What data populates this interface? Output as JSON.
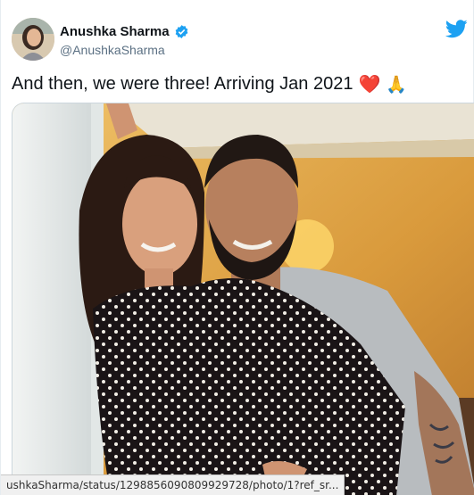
{
  "tweet": {
    "author_name": "Anushka Sharma",
    "author_handle": "@AnushkaSharma",
    "text": "And then, we were three! Arriving Jan 2021",
    "emoji_1": "❤️",
    "emoji_2": "🙏",
    "verified_icon": "verified-badge-icon",
    "platform_icon": "twitter-bird-icon",
    "colors": {
      "verified": "#1da1f2",
      "bird": "#1da1f2",
      "heart": "#e0245e"
    }
  },
  "browser": {
    "status_url": "ushkaSharma/status/1298856090809929728/photo/1?ref_sr..."
  }
}
